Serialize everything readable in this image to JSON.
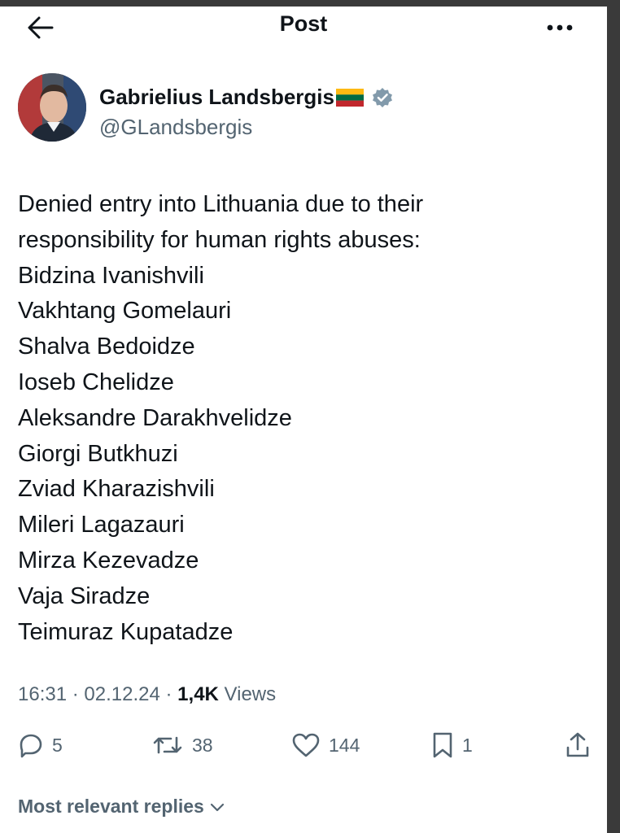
{
  "header": {
    "title": "Post",
    "back_icon": "arrow-left-icon",
    "more_icon": "more-horizontal-icon"
  },
  "author": {
    "name": "Gabrielius Landsbergis",
    "handle": "@GLandsbergis",
    "flag_icon": "lithuania-flag-icon",
    "verified_icon": "verified-badge-icon",
    "verified_color": "#829aab"
  },
  "post": {
    "lines": [
      "Denied entry into Lithuania due to their",
      "responsibility for human rights abuses:",
      "Bidzina Ivanishvili",
      "Vakhtang Gomelauri",
      "Shalva Bedoidze",
      "Ioseb Chelidze",
      "Aleksandre Darakhvelidze",
      "Giorgi Butkhuzi",
      "Zviad Kharazishvili",
      "Mileri Lagazauri",
      "Mirza Kezevadze",
      "Vaja Siradze",
      "Teimuraz Kupatadze"
    ],
    "time": "16:31",
    "date": "02.12.24",
    "views_count": "1,4K",
    "views_label": "Views",
    "separator": "·"
  },
  "actions": {
    "replies": "5",
    "reposts": "38",
    "likes": "144",
    "bookmarks": "1"
  },
  "replies_sort": {
    "label": "Most relevant replies"
  },
  "colors": {
    "text": "#0f1419",
    "secondary": "#536471",
    "flag_yellow": "#fdb913",
    "flag_green": "#006a44",
    "flag_red": "#c1272d"
  }
}
